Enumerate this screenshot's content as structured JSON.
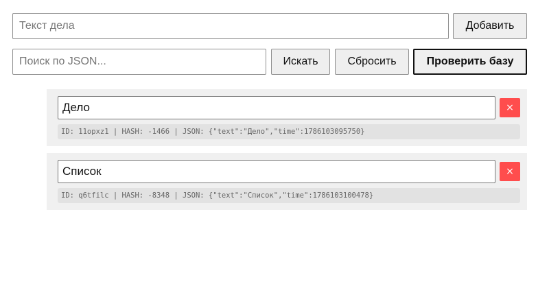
{
  "add_form": {
    "input_placeholder": "Текст дела",
    "input_value": "",
    "add_label": "Добавить"
  },
  "search_form": {
    "input_placeholder": "Поиск по JSON...",
    "input_value": "",
    "search_label": "Искать",
    "reset_label": "Сбросить",
    "check_label": "Проверить базу"
  },
  "items": [
    {
      "text": "Дело",
      "delete_label": "×",
      "meta": "ID: 11opxz1 | HASH: -1466 | JSON: {\"text\":\"Дело\",\"time\":1786103095750}"
    },
    {
      "text": "Список",
      "delete_label": "×",
      "meta": "ID: q6tfilc | HASH: -8348 | JSON: {\"text\":\"Список\",\"time\":1786103100478}"
    }
  ],
  "colors": {
    "delete_button": "#ff4d4d",
    "item_background": "#f0f0f0",
    "meta_background": "#e2e2e2"
  }
}
